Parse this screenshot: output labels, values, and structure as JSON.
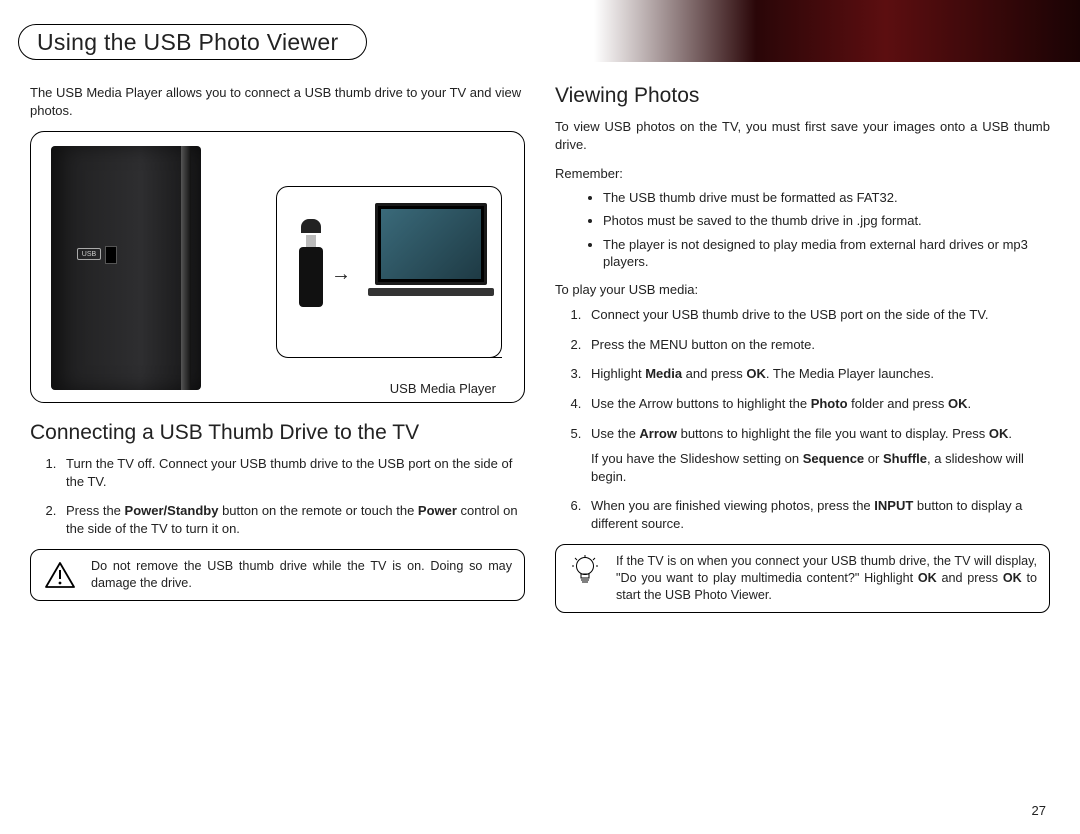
{
  "title": "Using the USB Photo Viewer",
  "page_number": "27",
  "left": {
    "intro": "The USB Media Player allows you to connect a USB thumb drive to your TV and view photos.",
    "figure_caption": "USB Media Player",
    "usb_port_label": "USB",
    "section_heading": "Connecting a USB Thumb Drive to the TV",
    "steps": [
      "Turn the TV off. Connect your USB thumb drive to the USB port on the side of the TV.",
      "Press the Power/Standby button on the remote or touch the Power control on the side of the TV to turn it on."
    ],
    "steps_bold": {
      "1": [
        "Power/Standby",
        "Power"
      ]
    },
    "warning": "Do not remove the USB thumb drive while the TV is on. Doing so may damage the drive."
  },
  "right": {
    "section_heading": "Viewing Photos",
    "intro": "To view USB photos on the TV, you must first save your images onto a USB thumb drive.",
    "remember_label": "Remember:",
    "remember_items": [
      "The USB thumb drive must be formatted as FAT32.",
      "Photos must be saved to the thumb drive in .jpg format.",
      "The player is not designed to play media from external hard drives or mp3 players."
    ],
    "toplay_label": "To play your USB media:",
    "steps": [
      "Connect your USB thumb drive to the USB port on the side of the TV.",
      "Press the MENU button on the remote.",
      "Highlight Media and press OK. The Media Player launches.",
      "Use the Arrow buttons to highlight the Photo folder and press OK.",
      "Use the Arrow buttons to highlight the file you want to display. Press OK.",
      "When you are finished viewing photos, press the INPUT button to display a different source."
    ],
    "slideshow_note": "If you have the Slideshow setting on Sequence or Shuffle, a slideshow will begin.",
    "tip": "If the TV is on when you connect your USB thumb drive, the TV will display, \"Do you want to play multimedia content?\" Highlight OK and press OK to start the USB Photo Viewer."
  }
}
